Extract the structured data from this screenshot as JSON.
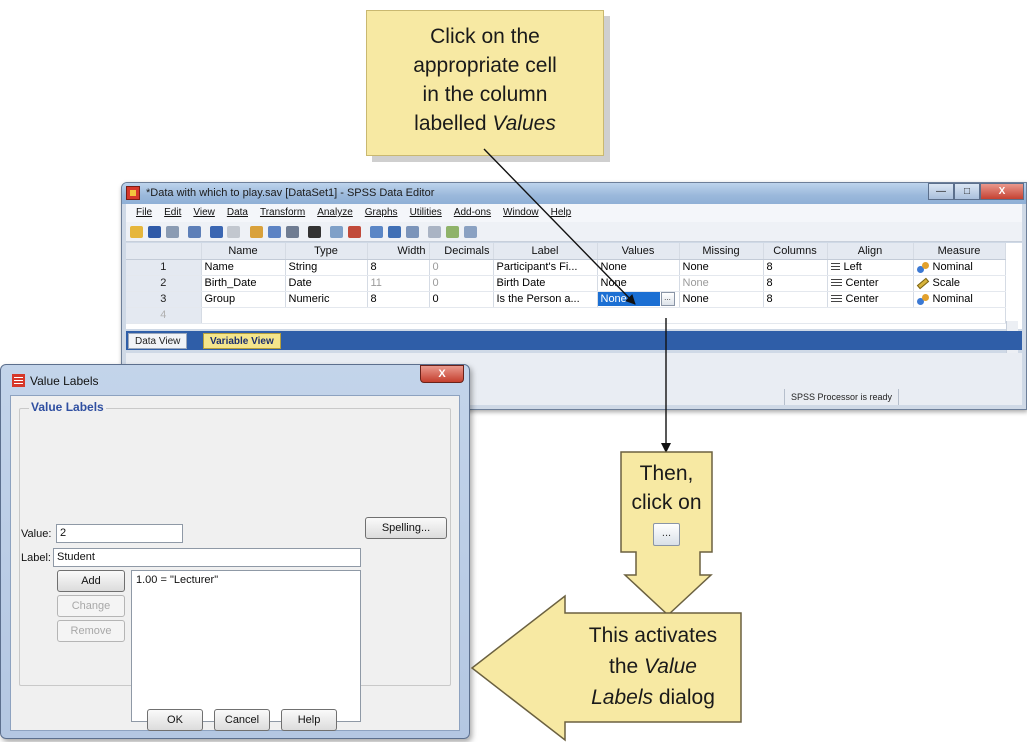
{
  "callouts": {
    "top_lines": [
      "Click on the",
      "appropriate cell",
      "in the column"
    ],
    "top_last_prefix": "labelled ",
    "top_last_italic": "Values",
    "then_lines": [
      "Then,",
      "click on"
    ],
    "then_button_glyph": "...",
    "activates_line1": "This activates",
    "activates_line2_prefix": "the ",
    "activates_line2_italic": "Value",
    "activates_line3_italic": "Labels",
    "activates_line3_suffix": " dialog"
  },
  "editor": {
    "title": "*Data with which to play.sav [DataSet1] - SPSS Data Editor",
    "window_buttons": [
      "—",
      "□",
      "X"
    ],
    "menu": [
      "File",
      "Edit",
      "View",
      "Data",
      "Transform",
      "Analyze",
      "Graphs",
      "Utilities",
      "Add-ons",
      "Window",
      "Help"
    ],
    "columns": [
      "Name",
      "Type",
      "Width",
      "Decimals",
      "Label",
      "Values",
      "Missing",
      "Columns",
      "Align",
      "Measure"
    ],
    "rows": [
      {
        "num": "1",
        "name": "Name",
        "type": "String",
        "width": "8",
        "decimals": "0",
        "label": "Participant's Fi...",
        "values": "None",
        "missing": "None",
        "columns": "8",
        "align": "Left",
        "measure": "Nominal"
      },
      {
        "num": "2",
        "name": "Birth_Date",
        "type": "Date",
        "width": "11",
        "decimals": "0",
        "label": "Birth Date",
        "values": "None",
        "missing": "None",
        "columns": "8",
        "align": "Center",
        "measure": "Scale"
      },
      {
        "num": "3",
        "name": "Group",
        "type": "Numeric",
        "width": "8",
        "decimals": "0",
        "label": "Is the Person a...",
        "values": "None",
        "missing": "None",
        "columns": "8",
        "align": "Center",
        "measure": "Nominal"
      },
      {
        "num": "4"
      }
    ],
    "cell_button_glyph": "...",
    "tabs": [
      "Data View",
      "Variable View"
    ],
    "status": "SPSS Processor is ready",
    "colors": {
      "selected_cell": "#1b6fd3",
      "active_tab": "#f4e58b"
    }
  },
  "dialog": {
    "title": "Value Labels",
    "close_glyph": "X",
    "group_title": "Value Labels",
    "value_label": "Value:",
    "value": "2",
    "label_label": "Label:",
    "label_value": "Student",
    "spelling_button": "Spelling...",
    "add_button": "Add",
    "change_button": "Change",
    "remove_button": "Remove",
    "list_items": [
      "1.00 = \"Lecturer\""
    ],
    "ok_button": "OK",
    "cancel_button": "Cancel",
    "help_button": "Help"
  }
}
